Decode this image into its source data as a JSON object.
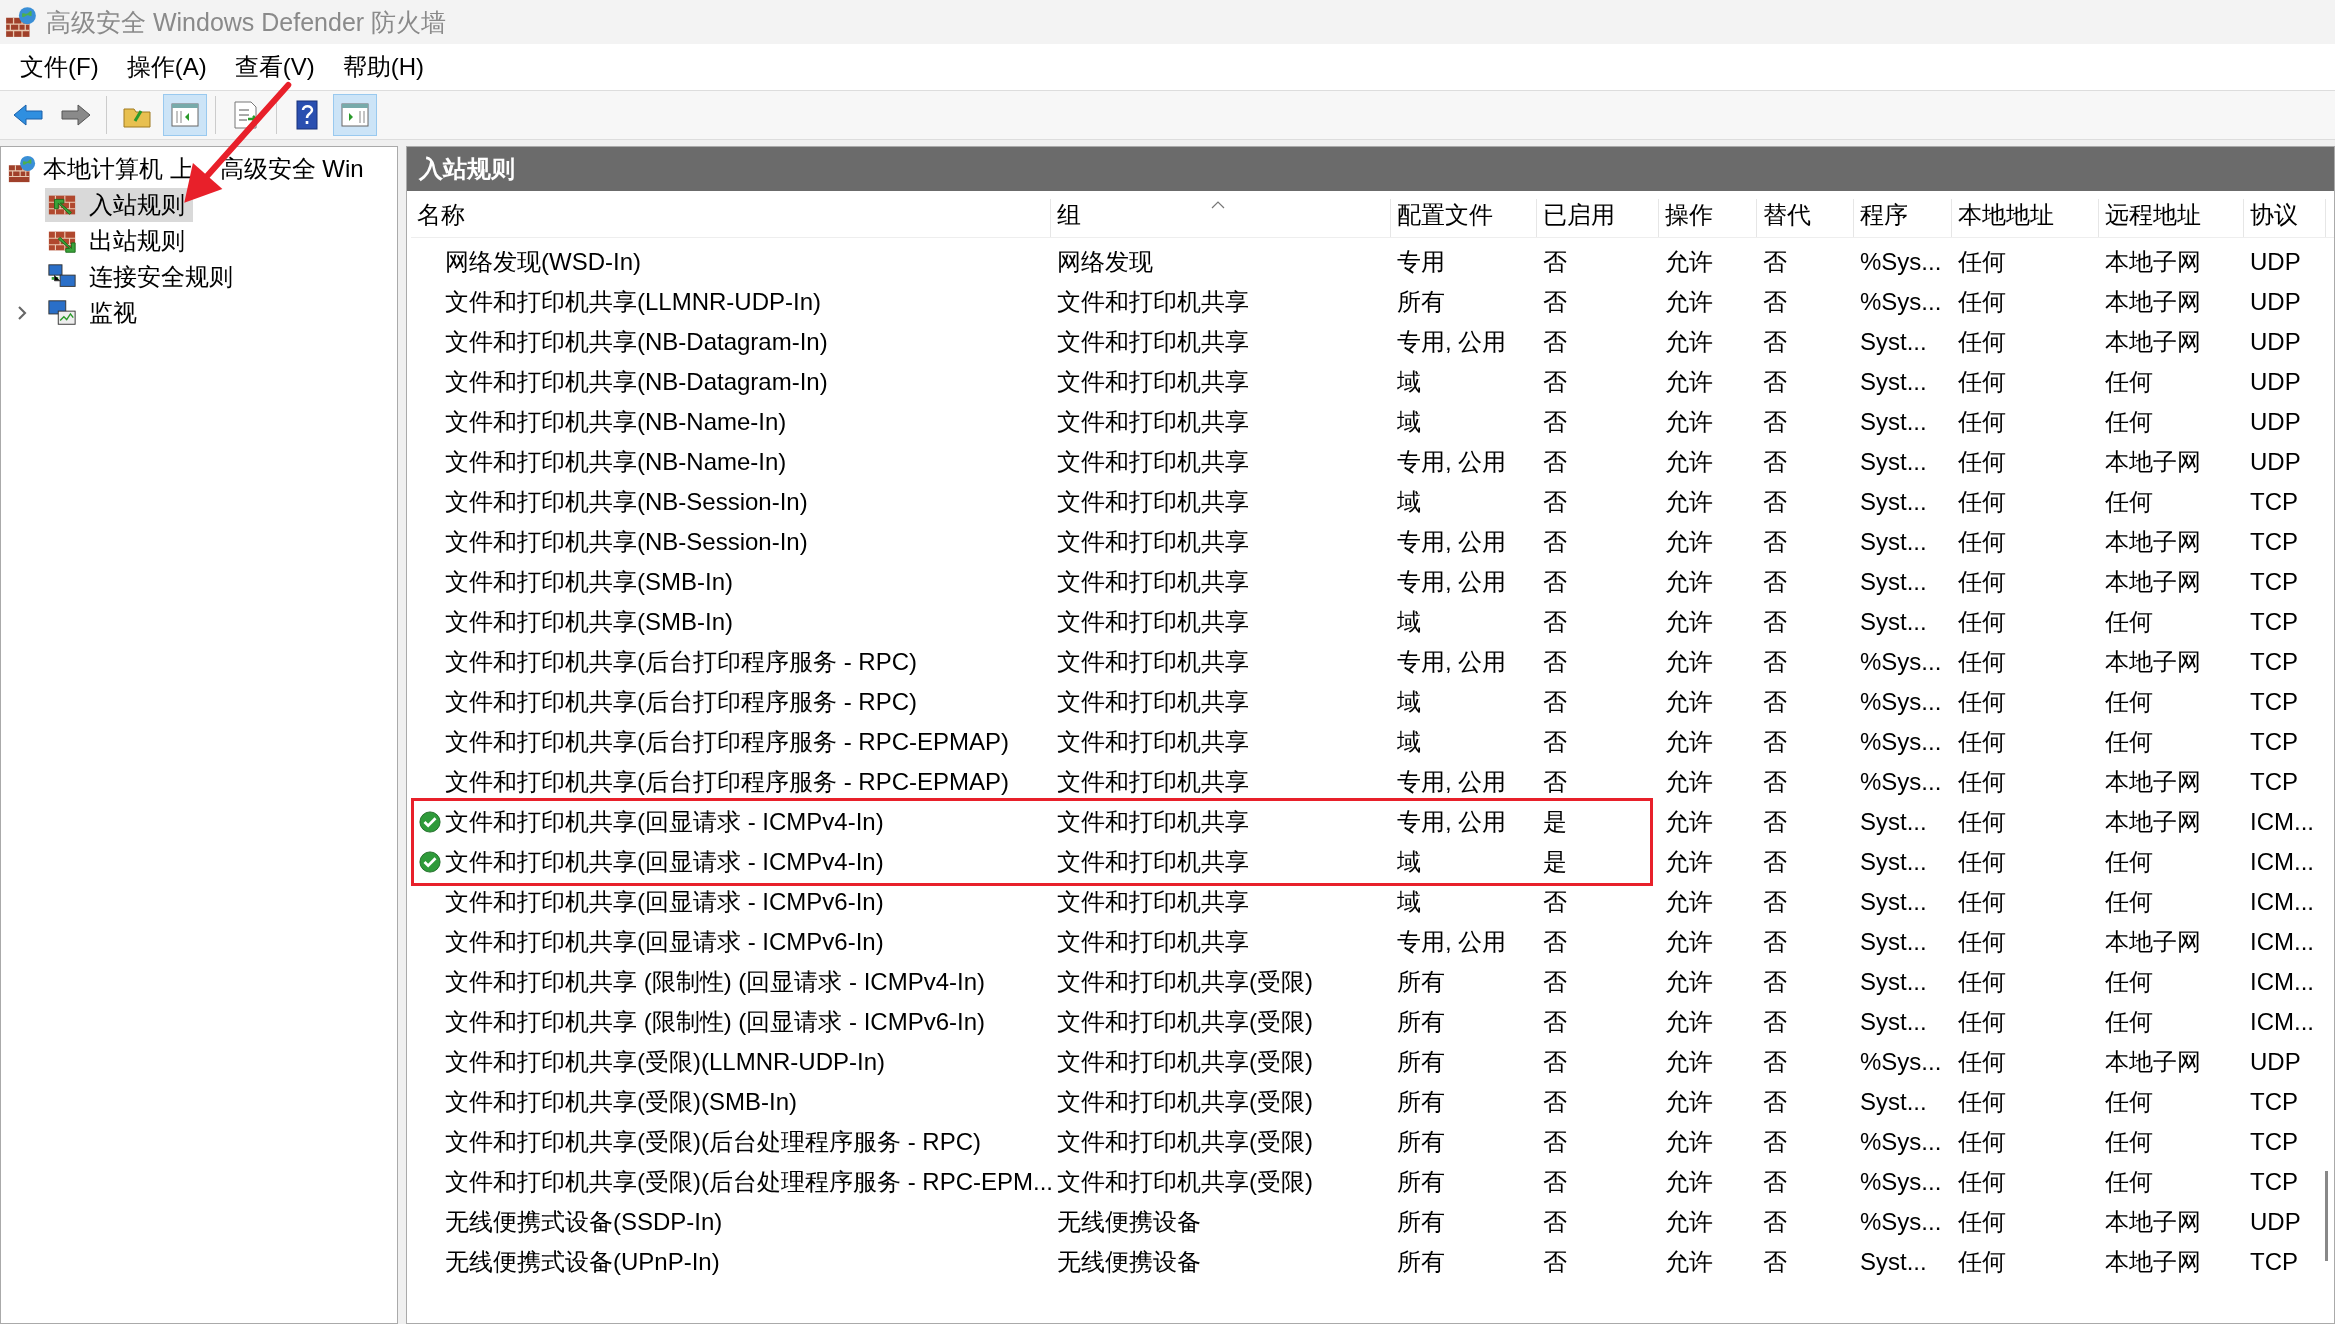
{
  "window": {
    "title": "高级安全 Windows Defender 防火墙"
  },
  "menu": [
    "文件(F)",
    "操作(A)",
    "查看(V)",
    "帮助(H)"
  ],
  "toolbar": [
    {
      "kind": "back",
      "pressed": false
    },
    {
      "kind": "forward",
      "pressed": false
    },
    {
      "kind": "separator"
    },
    {
      "kind": "up",
      "pressed": false
    },
    {
      "kind": "tree-toggle",
      "pressed": true
    },
    {
      "kind": "separator"
    },
    {
      "kind": "export",
      "pressed": false
    },
    {
      "kind": "separator"
    },
    {
      "kind": "help",
      "pressed": false
    },
    {
      "kind": "action-toggle",
      "pressed": true
    }
  ],
  "tree": {
    "label": "本地计算机 上",
    "label_2": "高级安全 Win",
    "children": [
      {
        "label": "入站规则",
        "kind": "inbound",
        "selected": true
      },
      {
        "label": "出站规则",
        "kind": "outbound",
        "selected": false
      },
      {
        "label": "连接安全规则",
        "kind": "security",
        "selected": false
      },
      {
        "label": "监视",
        "kind": "monitor",
        "selected": false,
        "expanded": false
      }
    ]
  },
  "panel": {
    "title": "入站规则"
  },
  "table": {
    "columns": [
      {
        "label": "名称",
        "sorted": false
      },
      {
        "label": "组",
        "sorted": true
      },
      {
        "label": "配置文件",
        "sorted": false
      },
      {
        "label": "已启用",
        "sorted": false
      },
      {
        "label": "操作",
        "sorted": false
      },
      {
        "label": "替代",
        "sorted": false
      },
      {
        "label": "程序",
        "sorted": false
      },
      {
        "label": "本地地址",
        "sorted": false
      },
      {
        "label": "远程地址",
        "sorted": false
      },
      {
        "label": "协议",
        "sorted": false
      }
    ],
    "rows": [
      {
        "enabled": false,
        "boxed": false,
        "cells": [
          "网络发现(WSD-In)",
          "网络发现",
          "专用",
          "否",
          "允许",
          "否",
          "%Sys...",
          "任何",
          "本地子网",
          "UDP"
        ]
      },
      {
        "enabled": false,
        "boxed": false,
        "cells": [
          "文件和打印机共享(LLMNR-UDP-In)",
          "文件和打印机共享",
          "所有",
          "否",
          "允许",
          "否",
          "%Sys...",
          "任何",
          "本地子网",
          "UDP"
        ]
      },
      {
        "enabled": false,
        "boxed": false,
        "cells": [
          "文件和打印机共享(NB-Datagram-In)",
          "文件和打印机共享",
          "专用, 公用",
          "否",
          "允许",
          "否",
          "Syst...",
          "任何",
          "本地子网",
          "UDP"
        ]
      },
      {
        "enabled": false,
        "boxed": false,
        "cells": [
          "文件和打印机共享(NB-Datagram-In)",
          "文件和打印机共享",
          "域",
          "否",
          "允许",
          "否",
          "Syst...",
          "任何",
          "任何",
          "UDP"
        ]
      },
      {
        "enabled": false,
        "boxed": false,
        "cells": [
          "文件和打印机共享(NB-Name-In)",
          "文件和打印机共享",
          "域",
          "否",
          "允许",
          "否",
          "Syst...",
          "任何",
          "任何",
          "UDP"
        ]
      },
      {
        "enabled": false,
        "boxed": false,
        "cells": [
          "文件和打印机共享(NB-Name-In)",
          "文件和打印机共享",
          "专用, 公用",
          "否",
          "允许",
          "否",
          "Syst...",
          "任何",
          "本地子网",
          "UDP"
        ]
      },
      {
        "enabled": false,
        "boxed": false,
        "cells": [
          "文件和打印机共享(NB-Session-In)",
          "文件和打印机共享",
          "域",
          "否",
          "允许",
          "否",
          "Syst...",
          "任何",
          "任何",
          "TCP"
        ]
      },
      {
        "enabled": false,
        "boxed": false,
        "cells": [
          "文件和打印机共享(NB-Session-In)",
          "文件和打印机共享",
          "专用, 公用",
          "否",
          "允许",
          "否",
          "Syst...",
          "任何",
          "本地子网",
          "TCP"
        ]
      },
      {
        "enabled": false,
        "boxed": false,
        "cells": [
          "文件和打印机共享(SMB-In)",
          "文件和打印机共享",
          "专用, 公用",
          "否",
          "允许",
          "否",
          "Syst...",
          "任何",
          "本地子网",
          "TCP"
        ]
      },
      {
        "enabled": false,
        "boxed": false,
        "cells": [
          "文件和打印机共享(SMB-In)",
          "文件和打印机共享",
          "域",
          "否",
          "允许",
          "否",
          "Syst...",
          "任何",
          "任何",
          "TCP"
        ]
      },
      {
        "enabled": false,
        "boxed": false,
        "cells": [
          "文件和打印机共享(后台打印程序服务 - RPC)",
          "文件和打印机共享",
          "专用, 公用",
          "否",
          "允许",
          "否",
          "%Sys...",
          "任何",
          "本地子网",
          "TCP"
        ]
      },
      {
        "enabled": false,
        "boxed": false,
        "cells": [
          "文件和打印机共享(后台打印程序服务 - RPC)",
          "文件和打印机共享",
          "域",
          "否",
          "允许",
          "否",
          "%Sys...",
          "任何",
          "任何",
          "TCP"
        ]
      },
      {
        "enabled": false,
        "boxed": false,
        "cells": [
          "文件和打印机共享(后台打印程序服务 - RPC-EPMAP)",
          "文件和打印机共享",
          "域",
          "否",
          "允许",
          "否",
          "%Sys...",
          "任何",
          "任何",
          "TCP"
        ]
      },
      {
        "enabled": false,
        "boxed": false,
        "cells": [
          "文件和打印机共享(后台打印程序服务 - RPC-EPMAP)",
          "文件和打印机共享",
          "专用, 公用",
          "否",
          "允许",
          "否",
          "%Sys...",
          "任何",
          "本地子网",
          "TCP"
        ]
      },
      {
        "enabled": true,
        "boxed": true,
        "cells": [
          "文件和打印机共享(回显请求 - ICMPv4-In)",
          "文件和打印机共享",
          "专用, 公用",
          "是",
          "允许",
          "否",
          "Syst...",
          "任何",
          "本地子网",
          "ICM..."
        ]
      },
      {
        "enabled": true,
        "boxed": true,
        "cells": [
          "文件和打印机共享(回显请求 - ICMPv4-In)",
          "文件和打印机共享",
          "域",
          "是",
          "允许",
          "否",
          "Syst...",
          "任何",
          "任何",
          "ICM..."
        ]
      },
      {
        "enabled": false,
        "boxed": false,
        "cells": [
          "文件和打印机共享(回显请求 - ICMPv6-In)",
          "文件和打印机共享",
          "域",
          "否",
          "允许",
          "否",
          "Syst...",
          "任何",
          "任何",
          "ICM..."
        ]
      },
      {
        "enabled": false,
        "boxed": false,
        "cells": [
          "文件和打印机共享(回显请求 - ICMPv6-In)",
          "文件和打印机共享",
          "专用, 公用",
          "否",
          "允许",
          "否",
          "Syst...",
          "任何",
          "本地子网",
          "ICM..."
        ]
      },
      {
        "enabled": false,
        "boxed": false,
        "cells": [
          "文件和打印机共享 (限制性) (回显请求 - ICMPv4-In)",
          "文件和打印机共享(受限)",
          "所有",
          "否",
          "允许",
          "否",
          "Syst...",
          "任何",
          "任何",
          "ICM..."
        ]
      },
      {
        "enabled": false,
        "boxed": false,
        "cells": [
          "文件和打印机共享 (限制性) (回显请求 - ICMPv6-In)",
          "文件和打印机共享(受限)",
          "所有",
          "否",
          "允许",
          "否",
          "Syst...",
          "任何",
          "任何",
          "ICM..."
        ]
      },
      {
        "enabled": false,
        "boxed": false,
        "cells": [
          "文件和打印机共享(受限)(LLMNR-UDP-In)",
          "文件和打印机共享(受限)",
          "所有",
          "否",
          "允许",
          "否",
          "%Sys...",
          "任何",
          "本地子网",
          "UDP"
        ]
      },
      {
        "enabled": false,
        "boxed": false,
        "cells": [
          "文件和打印机共享(受限)(SMB-In)",
          "文件和打印机共享(受限)",
          "所有",
          "否",
          "允许",
          "否",
          "Syst...",
          "任何",
          "任何",
          "TCP"
        ]
      },
      {
        "enabled": false,
        "boxed": false,
        "cells": [
          "文件和打印机共享(受限)(后台处理程序服务 - RPC)",
          "文件和打印机共享(受限)",
          "所有",
          "否",
          "允许",
          "否",
          "%Sys...",
          "任何",
          "任何",
          "TCP"
        ]
      },
      {
        "enabled": false,
        "boxed": false,
        "cells": [
          "文件和打印机共享(受限)(后台处理程序服务 - RPC-EPM...",
          "文件和打印机共享(受限)",
          "所有",
          "否",
          "允许",
          "否",
          "%Sys...",
          "任何",
          "任何",
          "TCP"
        ]
      },
      {
        "enabled": false,
        "boxed": false,
        "cells": [
          "无线便携式设备(SSDP-In)",
          "无线便携设备",
          "所有",
          "否",
          "允许",
          "否",
          "%Sys...",
          "任何",
          "本地子网",
          "UDP"
        ]
      },
      {
        "enabled": false,
        "boxed": false,
        "cells": [
          "无线便携式设备(UPnP-In)",
          "无线便携设备",
          "所有",
          "否",
          "允许",
          "否",
          "Syst...",
          "任何",
          "本地子网",
          "TCP"
        ]
      }
    ]
  }
}
